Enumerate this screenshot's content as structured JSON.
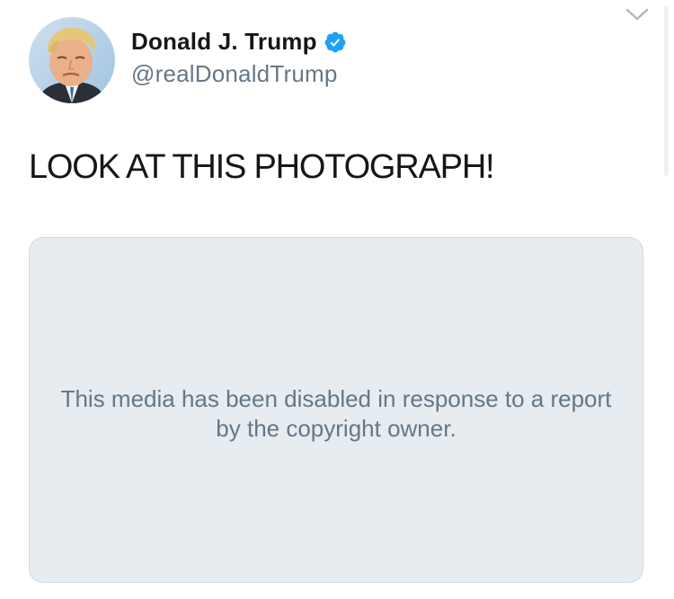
{
  "author": {
    "display_name": "Donald J. Trump",
    "handle": "@realDonaldTrump",
    "verified": true,
    "avatar_icon": "profile-photo"
  },
  "tweet": {
    "text": "LOOK AT THIS PHOTOGRAPH!"
  },
  "media": {
    "message": "This media has been disabled in response to a report by the copyright owner."
  },
  "icons": {
    "verified": "verified-check-icon",
    "menu": "chevron-down-icon"
  },
  "colors": {
    "verified_blue": "#1da1f2",
    "text_primary": "#14171a",
    "text_secondary": "#657786",
    "media_background": "#e6ecf0"
  }
}
